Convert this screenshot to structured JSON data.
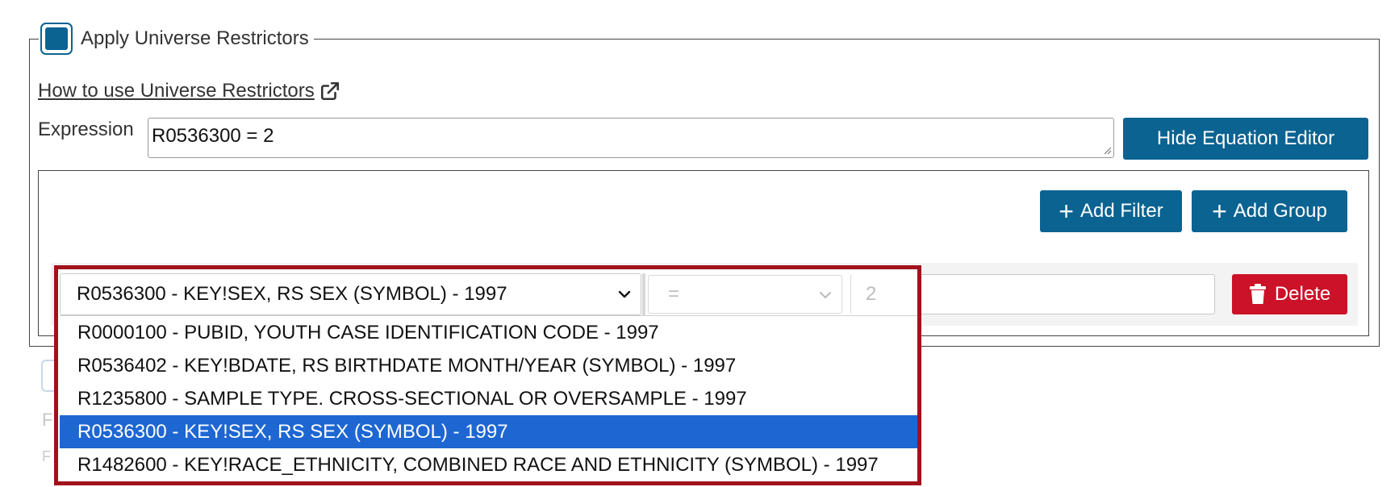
{
  "universe": {
    "checkbox_label": "Apply Universe Restrictors",
    "checked": true,
    "help_link": "How to use Universe Restrictors",
    "expression_label": "Expression",
    "expression_value": "R0536300 = 2",
    "hide_editor_button": "Hide Equation Editor"
  },
  "editor": {
    "add_filter_button": "Add Filter",
    "add_group_button": "Add Group",
    "rule": {
      "variable_selected": "R0536300 - KEY!SEX, RS SEX (SYMBOL) - 1997",
      "operator": "=",
      "value": "2",
      "delete_button": "Delete"
    },
    "dropdown_options": [
      "R0000100 - PUBID, YOUTH CASE IDENTIFICATION CODE - 1997",
      "R0536402 - KEY!BDATE, RS BIRTHDATE MONTH/YEAR (SYMBOL) - 1997",
      "R1235800 - SAMPLE TYPE. CROSS-SECTIONAL OR OVERSAMPLE - 1997",
      "R0536300 - KEY!SEX, RS SEX (SYMBOL) - 1997",
      "R1482600 - KEY!RACE_ETHNICITY, COMBINED RACE AND ETHNICITY (SYMBOL) - 1997"
    ],
    "selected_option_index": 3
  },
  "background_faded": {
    "line1": "F",
    "line2": "F"
  },
  "icons": {
    "external_link": "external-link-icon",
    "plus": "plus-icon",
    "trash": "trash-icon",
    "chevron": "chevron-down-icon"
  },
  "colors": {
    "primary": "#0b6391",
    "danger": "#cc1228",
    "highlight_frame": "#a2121b",
    "option_selected": "#1e67d2"
  }
}
